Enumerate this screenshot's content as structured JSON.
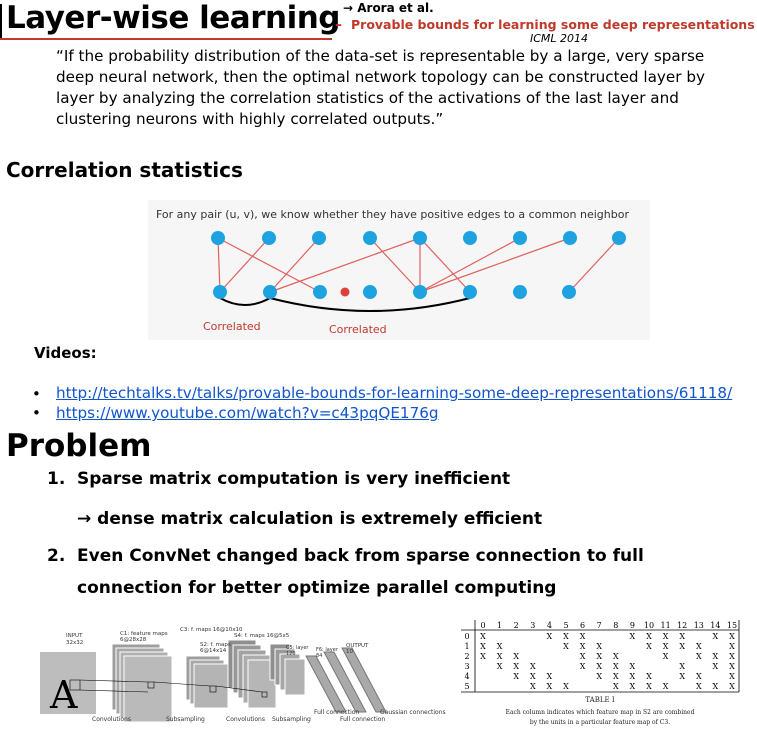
{
  "title": "Layer-wise learning",
  "reference": {
    "authors": "→ Arora et al.",
    "dash": "–",
    "paper": "Provable bounds for learning some deep representations",
    "venue": "ICML 2014"
  },
  "quote": "“If the probability distribution of the data-set is representable by a large, very sparse deep neural network, then the optimal network topology can be constructed layer by layer by analyzing the correlation statistics of the activations of the last layer and clustering neurons with highly correlated outputs.”",
  "correlation": {
    "heading": "Correlation statistics",
    "caption": "For any pair (u, v), we know whether they have positive edges to a common neighbor",
    "label_1": "Correlated",
    "label_2": "Correlated",
    "colors": {
      "node": "#1ea2e0",
      "edge": "#e06060",
      "highlight": "#e0403c"
    }
  },
  "videos": {
    "heading": "Videos:",
    "bullet": "•",
    "links": [
      "http://techtalks.tv/talks/provable-bounds-for-learning-some-deep-representations/61118/",
      "https://www.youtube.com/watch?v=c43pqQE176g"
    ]
  },
  "problem": {
    "heading": "Problem",
    "items": [
      {
        "number": "1.",
        "text": "Sparse matrix computation is very inefficient"
      },
      {
        "number": "",
        "text": "→ dense matrix calculation is extremely efficient"
      },
      {
        "number": "2.",
        "text": "Even ConvNet changed back from sparse connection to full"
      },
      {
        "number": "",
        "text": "connection for better optimize parallel computing"
      }
    ]
  },
  "lenet_figure": {
    "input": "INPUT",
    "input_size": "32x32",
    "c1": "C1: feature maps",
    "c1_size": "6@28x28",
    "c3": "C3: f. maps 16@10x10",
    "s2": "S2: f. maps",
    "s2_size": "6@14x14",
    "s4": "S4: f. maps 16@5x5",
    "c5": "C5: layer",
    "c5_size": "120",
    "f6": "F6: layer",
    "f6_size": "84",
    "output": "OUTPUT",
    "output_size": "10",
    "bottom_labels": [
      "Convolutions",
      "Subsampling",
      "Convolutions",
      "Subsampling",
      "Full connection",
      "Full connection"
    ],
    "gaussian": "Gaussian connections",
    "letter": "A"
  },
  "table_figure": {
    "columns": [
      "0",
      "1",
      "2",
      "3",
      "4",
      "5",
      "6",
      "7",
      "8",
      "9",
      "10",
      "11",
      "12",
      "13",
      "14",
      "15"
    ],
    "rows": [
      "0",
      "1",
      "2",
      "3",
      "4",
      "5"
    ],
    "matrix": [
      [
        1,
        0,
        0,
        0,
        1,
        1,
        1,
        0,
        0,
        1,
        1,
        1,
        1,
        0,
        1,
        1
      ],
      [
        1,
        1,
        0,
        0,
        0,
        1,
        1,
        1,
        0,
        0,
        1,
        1,
        1,
        1,
        0,
        1
      ],
      [
        1,
        1,
        1,
        0,
        0,
        0,
        1,
        1,
        1,
        0,
        0,
        1,
        0,
        1,
        1,
        1
      ],
      [
        0,
        1,
        1,
        1,
        0,
        0,
        1,
        1,
        1,
        1,
        0,
        0,
        1,
        0,
        1,
        1
      ],
      [
        0,
        0,
        1,
        1,
        1,
        0,
        0,
        1,
        1,
        1,
        1,
        0,
        1,
        1,
        0,
        1
      ],
      [
        0,
        0,
        0,
        1,
        1,
        1,
        0,
        0,
        1,
        1,
        1,
        1,
        0,
        1,
        1,
        1
      ]
    ],
    "mark": "X",
    "caption_title": "TABLE I",
    "caption_line_1": "Each column indicates which feature map in S2 are combined",
    "caption_line_2": "by the units in a particular feature map of C3."
  }
}
